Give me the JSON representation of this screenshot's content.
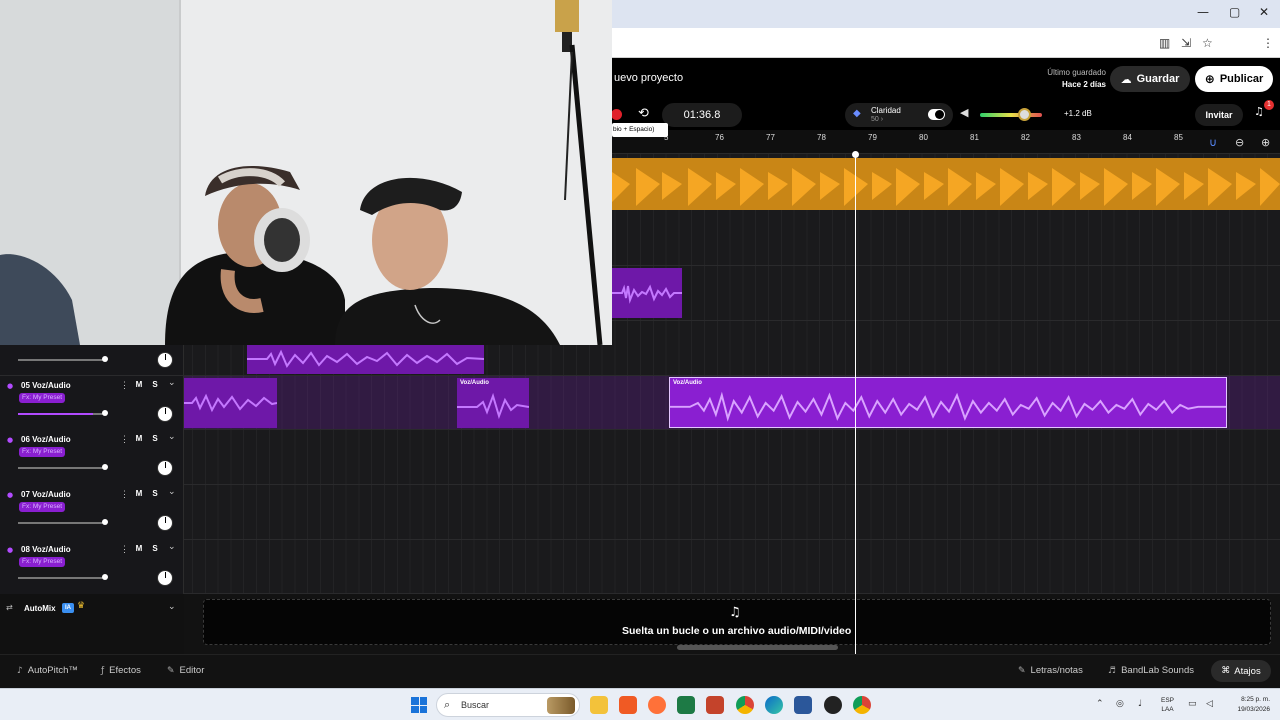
{
  "browser": {
    "window_controls": [
      "—",
      "▢",
      "✕"
    ]
  },
  "header": {
    "project_title": "uevo proyecto",
    "last_saved_label": "Último guardado",
    "last_saved_value": "Hace 2 días",
    "save_label": "Guardar",
    "publish_label": "Publicar"
  },
  "transport": {
    "time": "01:36.8",
    "tooltip": "bio + Espacio)",
    "clarity_label": "Claridad",
    "clarity_value": "50 ›",
    "db": "+1.2 dB",
    "invite_label": "Invitar",
    "notification_count": "1",
    "volume_level": 0.7
  },
  "ruler": {
    "labels": [
      "5",
      "76",
      "77",
      "78",
      "79",
      "80",
      "81",
      "82",
      "83",
      "84",
      "85"
    ]
  },
  "tracks": [
    {
      "num": "05",
      "name": "Voz/Audio",
      "fx": "Fx: My Preset",
      "m": "M",
      "s": "S"
    },
    {
      "num": "06",
      "name": "Voz/Audio",
      "fx": "Fx: My Preset",
      "m": "M",
      "s": "S"
    },
    {
      "num": "07",
      "name": "Voz/Audio",
      "fx": "Fx: My Preset",
      "m": "M",
      "s": "S"
    },
    {
      "num": "08",
      "name": "Voz/Audio",
      "fx": "Fx: My Preset",
      "m": "M",
      "s": "S"
    }
  ],
  "regions": {
    "label_a": "Voz/Audio",
    "label_b": "Voz/Audio"
  },
  "automix": {
    "label": "AutoMix",
    "badge": "IA"
  },
  "drop_zone": {
    "text": "Suelta un bucle o un archivo audio/MIDI/video"
  },
  "bottom_bar": {
    "autopitch": "AutoPitch™",
    "effects": "Efectos",
    "editor": "Editor",
    "lyrics": "Letras/notas",
    "sounds": "BandLab Sounds",
    "shortcuts": "Atajos"
  },
  "taskbar": {
    "search": "Buscar",
    "lang1": "ESP",
    "lang2": "LAA",
    "time": "8:25 p. m.",
    "date": "19/03/2026"
  },
  "colors": {
    "accent_purple": "#8a1fd1",
    "region_orange": "#f5a623",
    "record_red": "#e0202a"
  }
}
